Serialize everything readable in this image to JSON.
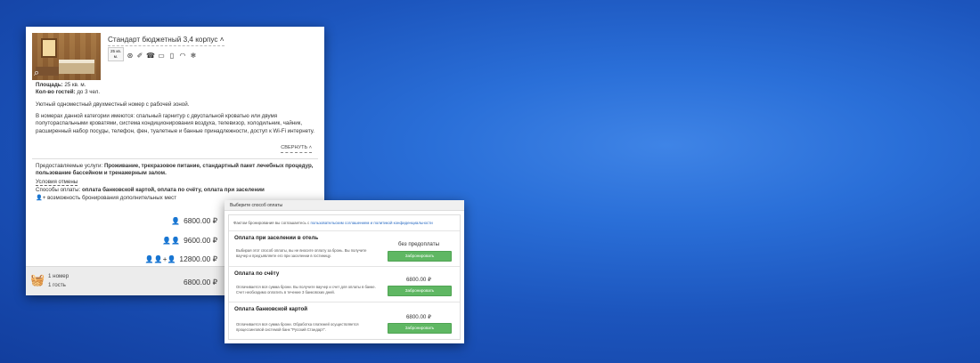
{
  "room": {
    "title": "Стандарт бюджетный 3,4 корпус ˄",
    "area_chip_line1": "25 кв.",
    "area_chip_line2": "м.",
    "amenities": [
      {
        "name": "ac-icon",
        "glyph": "⊛"
      },
      {
        "name": "hairdryer-icon",
        "glyph": "✐"
      },
      {
        "name": "phone-icon",
        "glyph": "☎"
      },
      {
        "name": "tv-icon",
        "glyph": "▭"
      },
      {
        "name": "fridge-icon",
        "glyph": "▯"
      },
      {
        "name": "wifi-icon",
        "glyph": "◠"
      },
      {
        "name": "snowflake-icon",
        "glyph": "❄"
      }
    ],
    "area_label": "Площадь:",
    "area_value": " 25 кв. м.",
    "guests_label": "Кол-во гостей:",
    "guests_value": " до 3 чел.",
    "summary": "Уютный одноместный двухместный номер с рабочей зоной.",
    "description": "В номерах данной категории имеются: спальный гарнитур с двуспальной кроватью или двумя полутораспальными кроватями, система кондиционирования воздуха, телевизор, холодильник, чайник, расширенный набор посуды, телефон, фен, туалетные и банные принадлежности, доступ к Wi-Fi интернету.",
    "collapse_label": "СВЕРНУТЬ ˄"
  },
  "services": {
    "label": "Предоставляемые услуги:",
    "value": " Проживание, трехразовое питание, стандартный пакет лечебных процедур, пользование бассейном и тренажерным залом.",
    "cancel_label": "Условия отмены",
    "payment_label": "Способы оплаты:",
    "payment_value": " оплата банковской картой, оплата по счёту, оплата при заселении",
    "extra_icon": "👤+",
    "extra_label": "возможность бронирования дополнительных мест"
  },
  "prices": [
    {
      "people": "👤",
      "amount": "6800.00 ₽"
    },
    {
      "people": "👤👤",
      "amount": "9600.00 ₽"
    },
    {
      "people": "👤👤+👤",
      "amount": "12800.00 ₽"
    }
  ],
  "cart": {
    "icon": "🧺",
    "rooms": "1 номер",
    "guests": "1 гость",
    "total": "6800.00 ₽"
  },
  "payment": {
    "header": "Выберите способ оплаты",
    "agree_text": "Фактом бронирования вы соглашаетесь с ",
    "agree_link": "пользовательским соглашением и политикой конфиденциальности",
    "options": [
      {
        "title": "Оплата при заселении в отель",
        "desc": "Выбирая этот способ оплаты, вы не вносите оплату за бронь. Вы получите ваучер и предъявляете его при заселении в гостиницу.",
        "price": "без предоплаты",
        "button": "Забронировать"
      },
      {
        "title": "Оплата по счёту",
        "desc": "Оплачивается вся сумма брони. Вы получите ваучер и счет для оплаты в банке. Счет необходимо оплатить в течение 3 банковских дней.",
        "price": "6800.00 ₽",
        "button": "Забронировать"
      },
      {
        "title": "Оплата банковской картой",
        "desc": "Оплачивается вся сумма брони. Обработка платежей осуществляется процессинговой системой банк \"Русский Стандарт\".",
        "price": "6800.00 ₽",
        "button": "Забронировать"
      }
    ]
  }
}
